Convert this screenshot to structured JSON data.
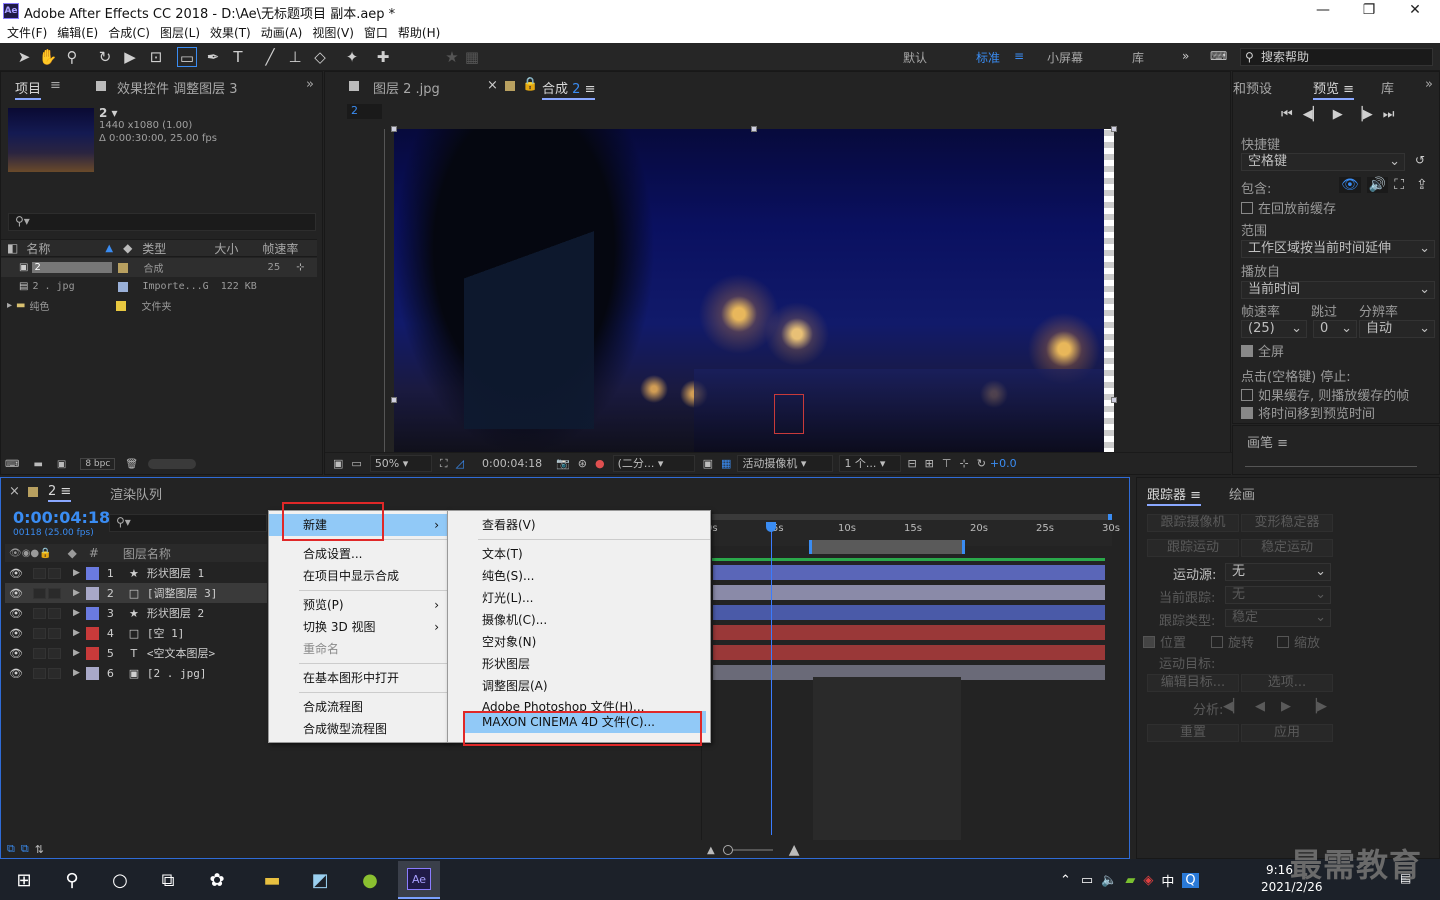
{
  "window": {
    "title": "Adobe After Effects CC 2018 - D:\\Ae\\无标题项目 副本.aep *",
    "app_badge": "Ae"
  },
  "menubar": [
    "文件(F)",
    "编辑(E)",
    "合成(C)",
    "图层(L)",
    "效果(T)",
    "动画(A)",
    "视图(V)",
    "窗口",
    "帮助(H)"
  ],
  "toolbar": {
    "workspaces": [
      "默认",
      "标准",
      "小屏幕",
      "库"
    ],
    "active_workspace": "标准",
    "search_placeholder": "搜索帮助"
  },
  "project": {
    "tab_project": "项目",
    "tab_effects": "效果控件 调整图层 3",
    "comp_name": "2",
    "comp_size": "1440 x1080 (1.00)",
    "comp_duration": "Δ 0:00:30:00, 25.00 fps",
    "columns": [
      "名称",
      "类型",
      "大小",
      "帧速率"
    ],
    "items": [
      {
        "name": "2",
        "type": "合成",
        "size": "",
        "fps": "25",
        "color": "#b8a060"
      },
      {
        "name": "2 . jpg",
        "type": "Importe...G",
        "size": "122 KB",
        "fps": "",
        "color": "#9ab0d8"
      },
      {
        "name": "纯色",
        "type": "文件夹",
        "size": "",
        "fps": "",
        "color": "#e8c840"
      }
    ],
    "bpc": "8 bpc"
  },
  "viewer": {
    "tab_footage": "图层 2 .jpg",
    "tab_comp": "合成",
    "tab_comp_num": "2",
    "breadcrumb": "2",
    "zoom": "50%",
    "timecode": "0:00:04:18",
    "resolution": "(二分...",
    "camera": "活动摄像机",
    "views": "1 个...",
    "exposure": "+0.0"
  },
  "preview": {
    "tab_info": "和预设",
    "tab_preview": "预览",
    "tab_lib": "库",
    "shortcut_label": "快捷键",
    "shortcut_value": "空格键",
    "include_label": "包含:",
    "cache_before": "在回放前缓存",
    "range_label": "范围",
    "range_value": "工作区域按当前时间延伸",
    "play_from_label": "播放自",
    "play_from_value": "当前时间",
    "fps_label": "帧速率",
    "skip_label": "跳过",
    "res_label": "分辨率",
    "fps_value": "(25)",
    "skip_value": "0",
    "res_value": "自动",
    "fullscreen": "全屏",
    "stop_label": "点击(空格键) 停止:",
    "opt1": "如果缓存, 则播放缓存的帧",
    "opt2": "将时间移到预览时间",
    "brush_tab": "画笔"
  },
  "timeline": {
    "tab_comp": "2",
    "tab_render": "渲染队列",
    "timecode": "0:00:04:18",
    "frames": "00118 (25.00 fps)",
    "col_layer_name": "图层名称",
    "ruler_labels": [
      "0s",
      "5s",
      "10s",
      "15s",
      "20s",
      "25s",
      "30s"
    ],
    "layers": [
      {
        "num": "1",
        "name": "形状图层 1",
        "icon": "★",
        "color": "#6a7ae0",
        "bar": "#5a66b8"
      },
      {
        "num": "2",
        "name": "[调整图层 3]",
        "icon": "□",
        "color": "#a8a8c8",
        "bar": "#8a8aa8"
      },
      {
        "num": "3",
        "name": "形状图层 2",
        "icon": "★",
        "color": "#6a7ae0",
        "bar": "#4a5aa8"
      },
      {
        "num": "4",
        "name": "[空 1]",
        "icon": "□",
        "color": "#c83a3a",
        "bar": "#9a3838"
      },
      {
        "num": "5",
        "name": "<空文本图层>",
        "icon": "T",
        "color": "#c83a3a",
        "bar": "#9a3838"
      },
      {
        "num": "6",
        "name": "[2 . jpg]",
        "icon": "▣",
        "color": "#a8a8c8",
        "bar": "#6a6a78"
      }
    ]
  },
  "tracker": {
    "tab_tracker": "跟踪器",
    "tab_paint": "绘画",
    "btn_track_camera": "跟踪摄像机",
    "btn_warp": "变形稳定器",
    "btn_track_motion": "跟踪运动",
    "btn_stabilize": "稳定运动",
    "source_label": "运动源:",
    "source_value": "无",
    "current_label": "当前跟踪:",
    "current_value": "无",
    "type_label": "跟踪类型:",
    "type_value": "稳定",
    "cb_position": "位置",
    "cb_rotation": "旋转",
    "cb_scale": "缩放",
    "target_label": "运动目标:",
    "btn_edit_target": "编辑目标...",
    "btn_options": "选项...",
    "analyze_label": "分析:",
    "btn_reset": "重置",
    "btn_apply": "应用"
  },
  "context_menu": {
    "items": [
      "新建",
      "合成设置...",
      "在项目中显示合成",
      "预览(P)",
      "切换 3D 视图",
      "重命名",
      "在基本图形中打开",
      "合成流程图",
      "合成微型流程图"
    ]
  },
  "submenu": {
    "items": [
      "查看器(V)",
      "文本(T)",
      "纯色(S)...",
      "灯光(L)...",
      "摄像机(C)...",
      "空对象(N)",
      "形状图层",
      "调整图层(A)",
      "Adobe Photoshop 文件(H)...",
      "MAXON CINEMA 4D 文件(C)..."
    ]
  },
  "taskbar": {
    "time": "9:16",
    "date": "2021/2/26",
    "ime": "中",
    "ae_label": "Ae"
  },
  "watermark": "最需教育"
}
